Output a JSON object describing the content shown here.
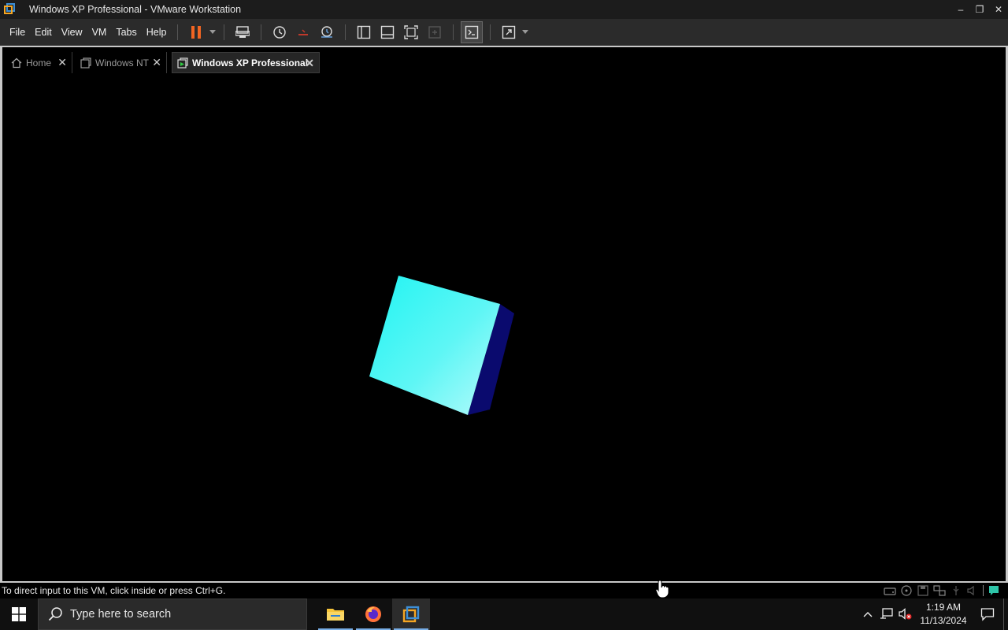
{
  "window": {
    "title": "Windows XP Professional - VMware Workstation",
    "controls": {
      "minimize": "–",
      "restore": "❐",
      "close": "✕"
    }
  },
  "menu": {
    "items": [
      "File",
      "Edit",
      "View",
      "VM",
      "Tabs",
      "Help"
    ]
  },
  "toolbar": {
    "icons": [
      "pause-icon",
      "send-ctrl-alt-del-icon",
      "snapshot-icon",
      "revert-snapshot-icon",
      "snapshot-manager-icon",
      "show-library-icon",
      "thumbnail-bar-icon",
      "full-screen-icon",
      "unity-icon",
      "console-view-icon",
      "stretch-guest-icon"
    ],
    "colors": {
      "pause": "#f26522"
    }
  },
  "tabs": [
    {
      "label": "Home",
      "close": "✕",
      "icon": "home-icon",
      "active": false
    },
    {
      "label": "Windows NT",
      "close": "✕",
      "icon": "vm-icon",
      "active": false
    },
    {
      "label": "Windows XP Professional",
      "close": "✕",
      "icon": "vm-running-icon",
      "active": true
    }
  ],
  "vm_screen": {
    "content": "rotating-cube",
    "colors": {
      "front": "#33f2ef",
      "side": "#0a0a6e"
    }
  },
  "status": {
    "text": "To direct input to this VM, click inside or press Ctrl+G.",
    "icons": [
      "hard-disk-icon",
      "cd-dvd-icon",
      "floppy-icon",
      "network-icon",
      "usb-icon",
      "sound-icon",
      "message-icon"
    ]
  },
  "taskbar": {
    "search_placeholder": "Type here to search",
    "apps": [
      "file-explorer-icon",
      "firefox-icon",
      "vmware-workstation-icon"
    ],
    "tray": {
      "time": "1:19 AM",
      "date": "11/13/2024",
      "icons": [
        "show-hidden-icons-icon",
        "network-status-icon",
        "volume-muted-icon",
        "action-center-icon"
      ]
    }
  }
}
